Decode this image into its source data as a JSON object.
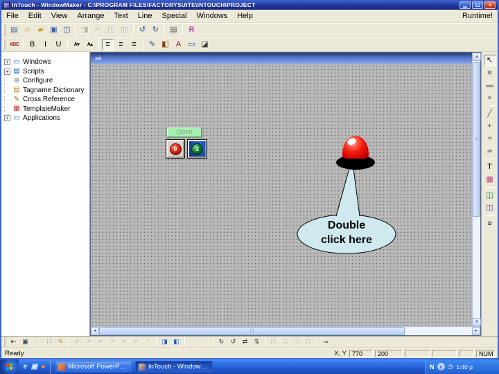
{
  "window": {
    "title": "InTouch - WindowMaker - C:\\PROGRAM FILES\\FACTORYSUITE\\INTOUCH\\PROJECT",
    "controls": {
      "minimize": "▁",
      "restore": "◱",
      "close": "x"
    }
  },
  "menu": {
    "items": [
      "File",
      "Edit",
      "View",
      "Arrange",
      "Text",
      "Line",
      "Special",
      "Windows",
      "Help"
    ],
    "runtime_label": "Runtime!"
  },
  "toolbar_main": {
    "items": [
      {
        "name": "new-window",
        "glyph": "▤",
        "color": "#4a6a9a"
      },
      {
        "name": "open-window",
        "glyph": "▱",
        "color": "#c8a020"
      },
      {
        "name": "close-window",
        "glyph": "▰",
        "color": "#c8a020"
      },
      {
        "name": "save-window",
        "glyph": "▣",
        "color": "#3858a0"
      },
      {
        "name": "save-all-windows",
        "glyph": "◫",
        "color": "#3858a0"
      },
      {
        "sep": true
      },
      {
        "name": "duplicate",
        "glyph": "◨",
        "enabled": false
      },
      {
        "name": "cut",
        "glyph": "✂",
        "enabled": false
      },
      {
        "name": "copy",
        "glyph": "◫",
        "enabled": false
      },
      {
        "name": "paste",
        "glyph": "▥",
        "enabled": false
      },
      {
        "sep": true
      },
      {
        "name": "undo",
        "glyph": "↺",
        "color": "#2a4a8a"
      },
      {
        "name": "redo",
        "glyph": "↻",
        "color": "#2a4a8a"
      },
      {
        "sep": true
      },
      {
        "name": "print",
        "glyph": "▤",
        "color": "#606060"
      },
      {
        "sep": true
      },
      {
        "name": "runtime-fast-switch",
        "glyph": "R",
        "color": "#c000c0"
      }
    ]
  },
  "toolbar_format": {
    "items": [
      {
        "name": "font",
        "glyph": "ABC",
        "small": true,
        "color": "#a02020"
      },
      {
        "sep": true
      },
      {
        "name": "bold",
        "glyph": "B",
        "color": "#000000"
      },
      {
        "name": "italic",
        "glyph": "I",
        "color": "#000000"
      },
      {
        "name": "underline",
        "glyph": "U",
        "color": "#000000"
      },
      {
        "sep": true
      },
      {
        "name": "reduce-font",
        "glyph": "A▾",
        "small": true,
        "color": "#000000"
      },
      {
        "name": "enlarge-font",
        "glyph": "A▴",
        "small": true,
        "color": "#000000"
      },
      {
        "sep": true
      },
      {
        "name": "align-left",
        "glyph": "≡",
        "pressed": true,
        "color": "#000000"
      },
      {
        "name": "align-center",
        "glyph": "≡",
        "color": "#000000"
      },
      {
        "name": "align-right",
        "glyph": "≡",
        "color": "#000000"
      },
      {
        "sep": true
      },
      {
        "name": "line-color",
        "glyph": "✎",
        "color": "#205080"
      },
      {
        "name": "fill-color",
        "glyph": "◧",
        "color": "#804010"
      },
      {
        "name": "text-color",
        "glyph": "A",
        "color": "#a01010"
      },
      {
        "name": "window-color",
        "glyph": "▭",
        "color": "#2050a0"
      },
      {
        "name": "transparent-color",
        "glyph": "◪",
        "color": "#404040"
      }
    ]
  },
  "right_tools": {
    "items": [
      {
        "name": "select-tool",
        "glyph": "↖",
        "pressed": true,
        "color": "#000000"
      },
      {
        "name": "rectangle-tool",
        "glyph": "■",
        "color": "#9a9a9a"
      },
      {
        "name": "rounded-rectangle-tool",
        "glyph": "▬",
        "color": "#9a9a9a"
      },
      {
        "name": "ellipse-tool",
        "glyph": "●",
        "color": "#9a9a9a"
      },
      {
        "sep": true
      },
      {
        "name": "line-tool",
        "glyph": "╱",
        "color": "#555555"
      },
      {
        "name": "hv-line-tool",
        "glyph": "+",
        "color": "#555555"
      },
      {
        "name": "polyline-tool",
        "glyph": "≈",
        "color": "#555555"
      },
      {
        "name": "polygon-tool",
        "glyph": "▰",
        "color": "#9a9a9a"
      },
      {
        "sep": true
      },
      {
        "name": "text-tool",
        "glyph": "T",
        "color": "#000000"
      },
      {
        "name": "bitmap-tool",
        "glyph": "▦",
        "color": "#b04070"
      },
      {
        "sep": true
      },
      {
        "name": "realtime-trend-tool",
        "glyph": "◫",
        "color": "#208040"
      },
      {
        "name": "historical-trend-tool",
        "glyph": "◫",
        "color": "#6040a0"
      },
      {
        "sep": true
      },
      {
        "name": "button-tool",
        "glyph": "D",
        "small": true,
        "color": "#000000"
      }
    ]
  },
  "toolbar_bottom": {
    "items": [
      {
        "name": "pointer-mode",
        "glyph": "⇤",
        "color": "#333333"
      },
      {
        "name": "window-mode",
        "glyph": "▣",
        "color": "#334466"
      },
      {
        "name": "selection-box",
        "glyph": "◌",
        "enabled": false
      },
      {
        "name": "snap-to-grid",
        "glyph": "∷",
        "color": "#666666"
      },
      {
        "name": "pen-style",
        "glyph": "✎",
        "color": "#b89000"
      },
      {
        "sep": true
      },
      {
        "name": "align-left",
        "glyph": "≡",
        "enabled": false
      },
      {
        "name": "align-center",
        "glyph": "≡",
        "enabled": false
      },
      {
        "name": "align-right",
        "glyph": "≡",
        "enabled": false
      },
      {
        "name": "align-top",
        "glyph": "≡",
        "enabled": false
      },
      {
        "name": "align-middle",
        "glyph": "≡",
        "enabled": false
      },
      {
        "name": "align-bottom",
        "glyph": "≡",
        "enabled": false
      },
      {
        "name": "align-centerpoints",
        "glyph": "*",
        "enabled": false
      },
      {
        "sep": true
      },
      {
        "name": "bring-to-front",
        "glyph": "◨",
        "color": "#2a5ac0"
      },
      {
        "name": "send-to-back",
        "glyph": "◧",
        "color": "#2a5ac0"
      },
      {
        "sep": true
      },
      {
        "name": "space-horizontal",
        "glyph": "⋯",
        "enabled": false
      },
      {
        "name": "space-vertical",
        "glyph": "⋮",
        "enabled": false
      },
      {
        "sep": true
      },
      {
        "name": "rotate-clockwise",
        "glyph": "↻",
        "color": "#333333"
      },
      {
        "name": "rotate-counterclockwise",
        "glyph": "↺",
        "color": "#333333"
      },
      {
        "name": "flip-horizontal",
        "glyph": "⇄",
        "color": "#333333"
      },
      {
        "name": "flip-vertical",
        "glyph": "⇅",
        "color": "#333333"
      },
      {
        "sep": true
      },
      {
        "name": "make-symbol",
        "glyph": "◰",
        "enabled": false
      },
      {
        "name": "break-symbol",
        "glyph": "◱",
        "enabled": false
      },
      {
        "name": "make-cell",
        "glyph": "◲",
        "enabled": false
      },
      {
        "name": "break-cell",
        "glyph": "◳",
        "enabled": false
      },
      {
        "sep": true
      },
      {
        "name": "reshape-object",
        "glyph": "↝",
        "color": "#555555"
      }
    ]
  },
  "tree": {
    "items": [
      {
        "label": "Windows",
        "icon": "windows-icon",
        "glyph": "▭",
        "color": "#3060c0",
        "expandable": true
      },
      {
        "label": "Scripts",
        "icon": "scripts-icon",
        "glyph": "▤",
        "color": "#3060c0",
        "expandable": true
      },
      {
        "label": "Configure",
        "icon": "configure-icon",
        "glyph": "⊛",
        "color": "#707070",
        "expandable": false
      },
      {
        "label": "Tagname Dictionary",
        "icon": "tagname-dictionary-icon",
        "glyph": "▤",
        "color": "#c07818",
        "expandable": false
      },
      {
        "label": "Cross Reference",
        "icon": "cross-reference-icon",
        "glyph": "✎",
        "color": "#8a6a2a",
        "expandable": false
      },
      {
        "label": "TemplateMaker",
        "icon": "templatemaker-icon",
        "glyph": "▦",
        "color": "#c03030",
        "expandable": false
      },
      {
        "label": "Applications",
        "icon": "applications-icon",
        "glyph": "▭",
        "color": "#3060c0",
        "expandable": true
      }
    ]
  },
  "canvas": {
    "title": "air",
    "open_button_label": "Open",
    "stop_button_label": "0",
    "start_button_label": "1",
    "bubble": {
      "line1": "Double",
      "line2": "click here"
    },
    "colors": {
      "bubble_fill": "#cfe9ee",
      "lamp_red": "#ee1313",
      "open_button_green": "#a9f1b2",
      "canvas_gray": "#b9b9b9"
    },
    "scrollbar": {
      "up": "▲",
      "down": "▼",
      "left": "◄",
      "right": "►",
      "grip": "|||",
      "vgrip": "≡"
    }
  },
  "statusbar": {
    "ready": "Ready",
    "xy_label": "X, Y",
    "x": "770",
    "y": "200",
    "num": "NUM"
  },
  "taskbar": {
    "quick_launch": [
      {
        "name": "internet-explorer-icon",
        "glyph": "e",
        "color": "#cfe6ff"
      },
      {
        "name": "show-desktop-icon",
        "glyph": "▣",
        "color": "#d8ecff"
      },
      {
        "name": "firefox-icon",
        "glyph": "●",
        "color": "#ff8c2a"
      }
    ],
    "tasks": [
      {
        "icon": "powerpoint-icon",
        "label": "Microsoft PowerPoint - ...",
        "active": false
      },
      {
        "icon": "intouch-icon",
        "label": "InTouch - WindowMak...",
        "active": true
      }
    ],
    "tray": {
      "n_badge": "N",
      "chevron": "‹",
      "clock_icon": "◷",
      "time": "1:40 p"
    }
  }
}
